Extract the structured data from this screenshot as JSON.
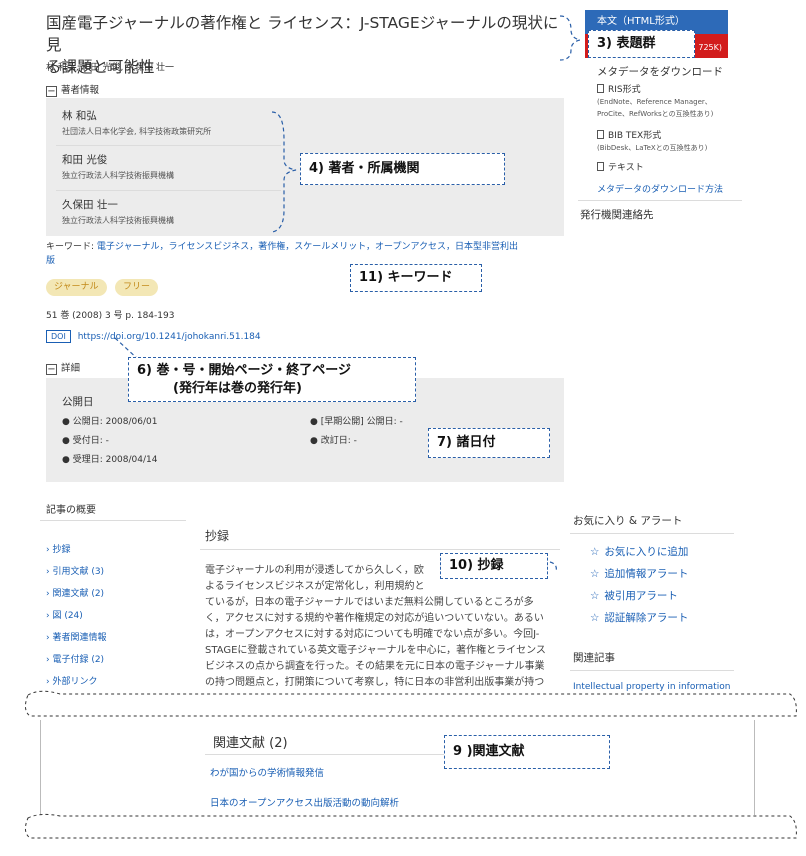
{
  "article": {
    "title_line1": "国産電子ジャーナルの著作権と ライセンス：J-STAGEジャーナルの現状に見",
    "title_line2": "る課題と可能性",
    "authors_line": "林 和弘, 和田 光俊, 久保田 壮一"
  },
  "author_info": {
    "heading": "著者情報",
    "authors": [
      {
        "name": "林 和弘",
        "affiliation": "社団法人日本化学会, 科学技術政策研究所"
      },
      {
        "name": "和田 光俊",
        "affiliation": "独立行政法人科学技術振興機構"
      },
      {
        "name": "久保田 壮一",
        "affiliation": "独立行政法人科学技術振興機構"
      }
    ]
  },
  "keywords": {
    "label": "キーワード:",
    "line1": "電子ジャーナル，ライセンスビジネス，著作権，スケールメリット，オープンアクセス，日本型非営利出",
    "line2": "版"
  },
  "badges": [
    "ジャーナル",
    "フリー"
  ],
  "citation": {
    "volume_line": "51 巻 (2008) 3 号 p. 184-193",
    "doi_label": "DOI",
    "doi_url": "https://doi.org/10.1241/johokanri.51.184"
  },
  "details": {
    "heading": "詳細",
    "pub_date_title": "公開日",
    "published": "● 公開日: 2008/06/01",
    "received": "● 受付日: -",
    "accepted": "● 受理日: 2008/04/14",
    "early_published": "● [早期公開] 公開日: -",
    "revised": "● 改訂日: -"
  },
  "sidebar_right": {
    "fulltext_button": "本文（HTML形式）",
    "pdf_size": "725K)",
    "metadata_heading": "メタデータをダウンロード",
    "ris_label": "RIS形式",
    "ris_note1": "(EndNote、Reference Manager、",
    "ris_note2": "ProCite、RefWorksとの互換性あり)",
    "bib_label": "BIB TEX形式",
    "bib_note": "(BibDesk、LaTeXとの互換性あり)",
    "text_label": "テキスト",
    "metadata_howto": "メタデータのダウンロード方法",
    "publisher_contact": "発行機関連絡先"
  },
  "overview": {
    "heading": "記事の概要",
    "items": [
      "› 抄録",
      "› 引用文献 (3)",
      "› 関連文献 (2)",
      "› 図 (24)",
      "› 著者関連情報",
      "› 電子付録 (2)",
      "› 外部リンク"
    ]
  },
  "abstract": {
    "heading": "抄録",
    "lines": [
      "電子ジャーナルの利用が浸透してから久しく，欧",
      "よるライセンスビジネスが定常化し，利用規約と",
      "ているが，日本の電子ジャーナルではいまだ無料公開しているところが多",
      "く，アクセスに対する規約や著作権規定の対応が追いついていない。あるい",
      "は，オープンアクセスに対する対応についても明確でない点が多い。今回J-",
      "STAGEに登載されている英文電子ジャーナルを中心に，著作権とライセンス",
      "ビジネスの点から調査を行った。その結果を元に日本の電子ジャーナル事業",
      "の持つ問題点と，打開策について考察し，特に日本の非営利出版事業が持つ"
    ]
  },
  "favorites": {
    "heading": "お気に入り & アラート",
    "items": [
      "お気に入りに追加",
      "追加情報アラート",
      "被引用アラート",
      "認証解除アラート"
    ],
    "related_heading": "関連記事",
    "related_link": "Intellectual property in information"
  },
  "related_refs": {
    "heading": "関連文献 (2)",
    "items": [
      "わが国からの学術情報発信",
      "日本のオープンアクセス出版活動の動向解析"
    ]
  },
  "callouts": {
    "c3": "3) 表題群",
    "c4": "4) 著者・所属機関",
    "c11": "11) キーワード",
    "c6_line1": "6) 巻・号・開始ページ・終了ページ",
    "c6_line2": "(発行年は巻の発行年)",
    "c7": "7) 諸日付",
    "c10": "10) 抄録",
    "c9": "9 )関連文献"
  }
}
